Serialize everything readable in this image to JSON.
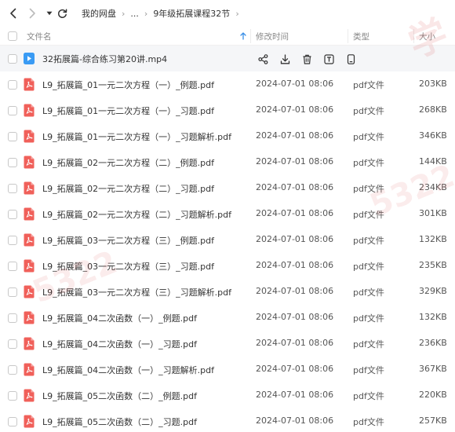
{
  "toolbar": {
    "breadcrumb": [
      "我的网盘",
      "...",
      "9年级拓展课程32节"
    ]
  },
  "header": {
    "name": "文件名",
    "modified": "修改时间",
    "type": "类型",
    "size": "大小"
  },
  "colors": {
    "pdf_icon": "#f0605a",
    "video_icon": "#3a9bf4",
    "highlight_row": "#f5f6f8"
  },
  "video_row": {
    "name": "32拓展篇-综合练习第20讲.mp4",
    "icon": "video-file-icon",
    "actions": [
      "share-icon",
      "download-icon",
      "delete-icon",
      "rename-icon",
      "more-icon"
    ]
  },
  "files": [
    {
      "name": "L9_拓展篇_01一元二次方程（一）_例题.pdf",
      "date": "2024-07-01 08:06",
      "type": "pdf文件",
      "size": "203KB"
    },
    {
      "name": "L9_拓展篇_01一元二次方程（一）_习题.pdf",
      "date": "2024-07-01 08:06",
      "type": "pdf文件",
      "size": "268KB"
    },
    {
      "name": "L9_拓展篇_01一元二次方程（一）_习题解析.pdf",
      "date": "2024-07-01 08:06",
      "type": "pdf文件",
      "size": "346KB"
    },
    {
      "name": "L9_拓展篇_02一元二次方程（二）_例题.pdf",
      "date": "2024-07-01 08:06",
      "type": "pdf文件",
      "size": "144KB"
    },
    {
      "name": "L9_拓展篇_02一元二次方程（二）_习题.pdf",
      "date": "2024-07-01 08:06",
      "type": "pdf文件",
      "size": "234KB"
    },
    {
      "name": "L9_拓展篇_02一元二次方程（二）_习题解析.pdf",
      "date": "2024-07-01 08:06",
      "type": "pdf文件",
      "size": "301KB"
    },
    {
      "name": "L9_拓展篇_03一元二次方程（三）_例题.pdf",
      "date": "2024-07-01 08:06",
      "type": "pdf文件",
      "size": "132KB"
    },
    {
      "name": "L9_拓展篇_03一元二次方程（三）_习题.pdf",
      "date": "2024-07-01 08:06",
      "type": "pdf文件",
      "size": "235KB"
    },
    {
      "name": "L9_拓展篇_03一元二次方程（三）_习题解析.pdf",
      "date": "2024-07-01 08:06",
      "type": "pdf文件",
      "size": "329KB"
    },
    {
      "name": "L9_拓展篇_04二次函数（一）_例题.pdf",
      "date": "2024-07-01 08:06",
      "type": "pdf文件",
      "size": "132KB"
    },
    {
      "name": "L9_拓展篇_04二次函数（一）_习题.pdf",
      "date": "2024-07-01 08:06",
      "type": "pdf文件",
      "size": "236KB"
    },
    {
      "name": "L9_拓展篇_04二次函数（一）_习题解析.pdf",
      "date": "2024-07-01 08:06",
      "type": "pdf文件",
      "size": "367KB"
    },
    {
      "name": "L9_拓展篇_05二次函数（二）_例题.pdf",
      "date": "2024-07-01 08:06",
      "type": "pdf文件",
      "size": "220KB"
    },
    {
      "name": "L9_拓展篇_05二次函数（二）_习题.pdf",
      "date": "2024-07-01 08:06",
      "type": "pdf文件",
      "size": "257KB"
    }
  ]
}
